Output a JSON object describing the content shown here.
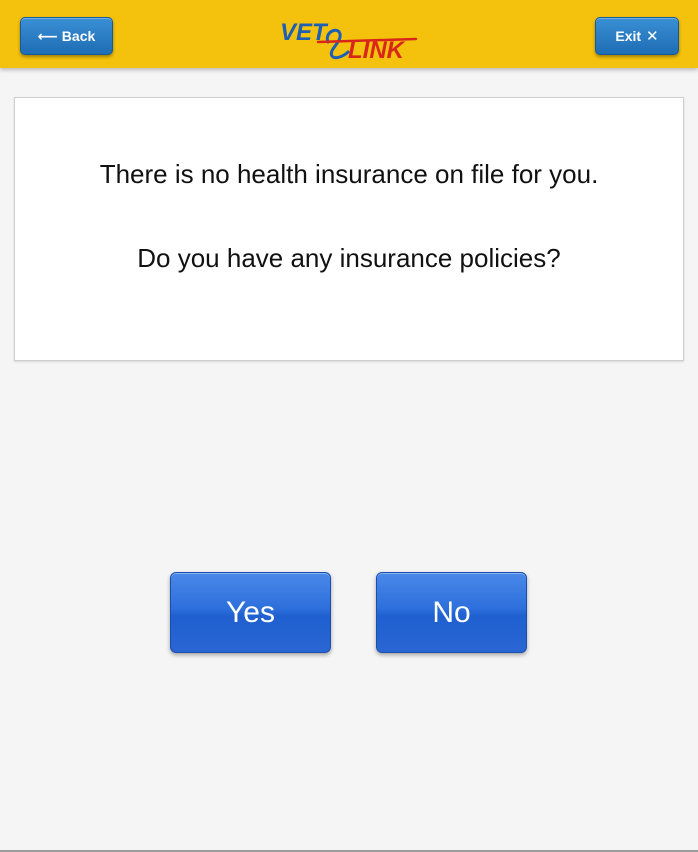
{
  "header": {
    "back_label": "Back",
    "back_icon": "arrow-left-icon",
    "exit_label": "Exit",
    "exit_icon": "close-icon",
    "logo_text_left": "VET",
    "logo_text_right": "LINK",
    "colors": {
      "bar": "#f4c20d",
      "button": "#2a7cc4",
      "logo_blue": "#1c5fb5",
      "logo_red": "#d8261b"
    }
  },
  "main": {
    "message_line_1": "There is no health insurance on file for you.",
    "message_line_2": "Do you have any insurance policies?"
  },
  "answers": {
    "yes_label": "Yes",
    "no_label": "No",
    "color": "#2d6fdc"
  }
}
